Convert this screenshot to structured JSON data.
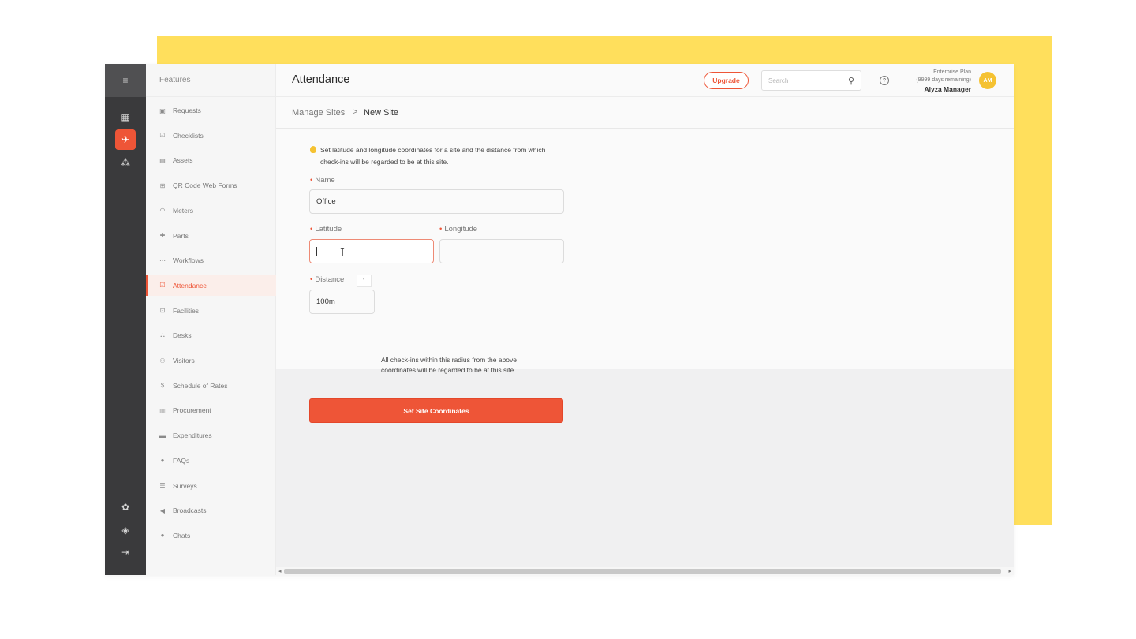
{
  "rail": {
    "items": [
      {
        "name": "dashboard-icon",
        "glyph": "▦"
      },
      {
        "name": "rocket-icon",
        "glyph": "✈",
        "active": true
      },
      {
        "name": "stats-icon",
        "glyph": "⁂"
      },
      {
        "name": "settings-icon",
        "glyph": "✿"
      },
      {
        "name": "box-icon",
        "glyph": "◈"
      },
      {
        "name": "logout-icon",
        "glyph": "⇥"
      }
    ]
  },
  "features": {
    "title": "Features",
    "items": [
      {
        "label": "Requests",
        "icon": "▣"
      },
      {
        "label": "Checklists",
        "icon": "☑"
      },
      {
        "label": "Assets",
        "icon": "▤"
      },
      {
        "label": "QR Code Web Forms",
        "icon": "⊞"
      },
      {
        "label": "Meters",
        "icon": "◠"
      },
      {
        "label": "Parts",
        "icon": "✚"
      },
      {
        "label": "Workflows",
        "icon": "⋯"
      },
      {
        "label": "Attendance",
        "icon": "☑",
        "active": true
      },
      {
        "label": "Facilities",
        "icon": "⊡"
      },
      {
        "label": "Desks",
        "icon": "⛬"
      },
      {
        "label": "Visitors",
        "icon": "⚇"
      },
      {
        "label": "Schedule of Rates",
        "icon": "$"
      },
      {
        "label": "Procurement",
        "icon": "▥"
      },
      {
        "label": "Expenditures",
        "icon": "▬"
      },
      {
        "label": "FAQs",
        "icon": "●"
      },
      {
        "label": "Surveys",
        "icon": "☰"
      },
      {
        "label": "Broadcasts",
        "icon": "◀"
      },
      {
        "label": "Chats",
        "icon": "●"
      }
    ]
  },
  "header": {
    "title": "Attendance",
    "upgrade_label": "Upgrade",
    "search_placeholder": "Search",
    "help_glyph": "?",
    "plan": "Enterprise Plan",
    "days": "(9999 days remaining)",
    "user_name": "Alyza Manager",
    "avatar_initials": "AM"
  },
  "breadcrumb": {
    "parent": "Manage Sites",
    "separator": ">",
    "current": "New Site"
  },
  "form": {
    "hint": "Set latitude and longitude coordinates for a site and the distance from which check-ins will be regarded to be at this site.",
    "name_label": "Name",
    "name_value": "Office",
    "latitude_label": "Latitude",
    "latitude_value": "",
    "longitude_label": "Longitude",
    "longitude_value": "",
    "distance_label": "Distance",
    "distance_value": "100m",
    "distance_tooltip": "1",
    "radius_note": "All check-ins within this radius from the above coordinates will be regarded to be at this site.",
    "submit_label": "Set Site Coordinates"
  },
  "colors": {
    "accent": "#ee5537",
    "rail_bg": "#3a3a3c",
    "backdrop": "#ffdf5c",
    "avatar": "#f5c232"
  }
}
